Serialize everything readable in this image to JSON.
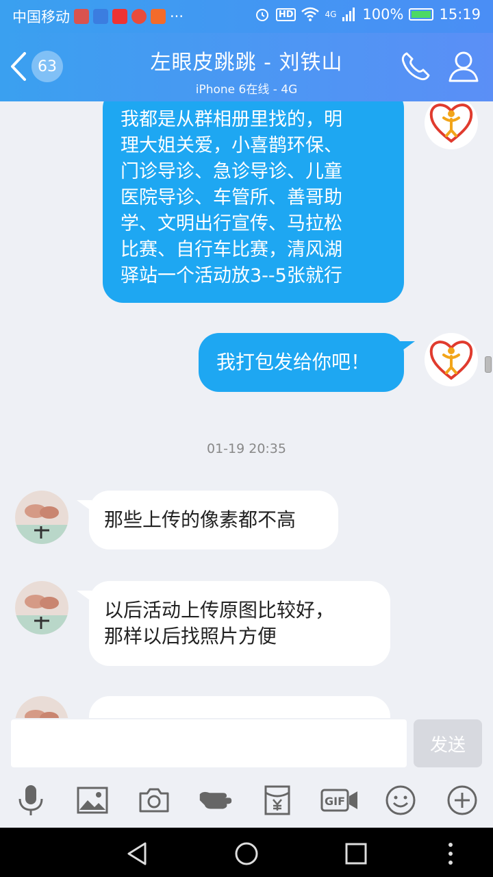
{
  "status_bar": {
    "carrier": "中国移动",
    "dots": "···",
    "hd": "HD",
    "network": "4G",
    "battery": "100%",
    "time": "15:19"
  },
  "header": {
    "unread_count": "63",
    "title": "左眼皮跳跳 - 刘铁山",
    "subtitle": "iPhone 6在线 - 4G"
  },
  "messages": [
    {
      "from": "me",
      "text": "我都是从群相册里找的，明理大姐关爱，小喜鹊环保、门诊导诊、急诊导诊、儿童医院导诊、车管所、善哥助学、文明出行宣传、马拉松比赛、自行车比赛，清风湖驿站一个活动放3--5张就行"
    },
    {
      "from": "me",
      "text": "我打包发给你吧！"
    },
    {
      "from": "them",
      "text": "那些上传的像素都不高"
    },
    {
      "from": "them",
      "text": "以后活动上传原图比较好，那样以后找照片方便"
    }
  ],
  "lines": {
    "m1": [
      "我都是从群相册里找的，明",
      "理大姐关爱，小喜鹊环保、",
      "门诊导诊、急诊导诊、儿童",
      "医院导诊、车管所、善哥助",
      "学、文明出行宣传、马拉松",
      "比赛、自行车比赛，清风湖",
      "驿站一个活动放3--5张就行"
    ],
    "m4": [
      "以后活动上传原图比较好，",
      "那样以后找照片方便"
    ]
  },
  "timestamp": "01-19 20:35",
  "input": {
    "placeholder": "",
    "send_label": "发送"
  },
  "toolbar_icons": [
    "microphone-icon",
    "image-icon",
    "camera-icon",
    "poke-icon",
    "red-packet-icon",
    "gif-icon",
    "emoji-icon",
    "plus-icon"
  ],
  "colors": {
    "header": "#4a95f3",
    "my_bubble": "#1ea7f2",
    "their_bubble": "#ffffff",
    "background": "#eef0f5"
  }
}
